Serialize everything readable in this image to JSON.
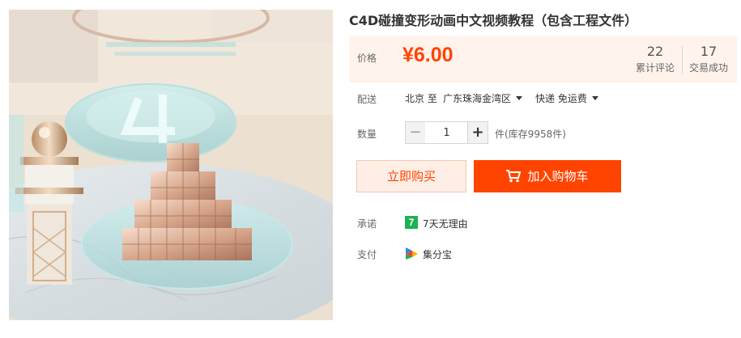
{
  "product": {
    "title": "C4D碰撞变形动画中文视频教程（包含工程文件）",
    "image_alt": "C4D product image"
  },
  "price": {
    "label": "价格",
    "value": "¥6.00",
    "reviews_count": "22",
    "reviews_label": "累计评论",
    "sales_count": "17",
    "sales_label": "交易成功"
  },
  "shipping": {
    "label": "配送",
    "origin": "北京 至",
    "destination": "广东珠海金湾区",
    "method": "快递 免运费"
  },
  "quantity": {
    "label": "数量",
    "minus": "−",
    "value": "1",
    "plus": "+",
    "stock": "件(库存9958件)"
  },
  "actions": {
    "buy_now": "立即购买",
    "add_to_cart": "加入购物车"
  },
  "promise": {
    "label": "承诺",
    "icon_text": "7",
    "text": "7天无理由"
  },
  "payment": {
    "label": "支付",
    "text": "集分宝"
  },
  "colors": {
    "accent": "#ff4400",
    "price_bg": "#fff3ec",
    "promise_green": "#1fb155"
  }
}
